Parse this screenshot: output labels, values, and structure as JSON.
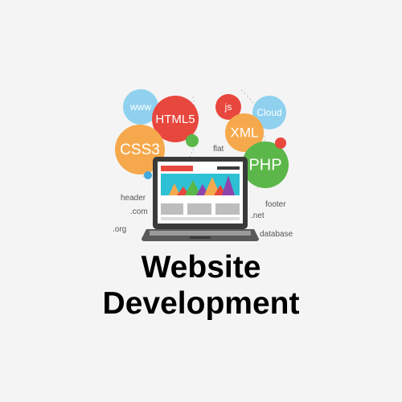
{
  "title": {
    "line1": "Website",
    "line2": "Development"
  },
  "bubbles": {
    "www": "www",
    "html5": "HTML5",
    "css3": "CSS3",
    "js": "js",
    "cloud": "Cloud",
    "xml": "XML",
    "php": "PHP"
  },
  "tags": {
    "flat": "flat",
    "header": "header",
    "com": ".com",
    "org": ".org",
    "footer": "footer",
    "net": ".net",
    "database": "database"
  },
  "colors": {
    "background": "#f4f4f4",
    "www": "#8fd1ef",
    "html5": "#e8473e",
    "css3": "#f6a94c",
    "js": "#e8473e",
    "cloud": "#8fd1ef",
    "xml": "#f6a94c",
    "php": "#5bb749",
    "accent_dot_green": "#5bb749",
    "accent_dot_red": "#e8473e",
    "accent_dot_blue": "#3fa9dd"
  }
}
